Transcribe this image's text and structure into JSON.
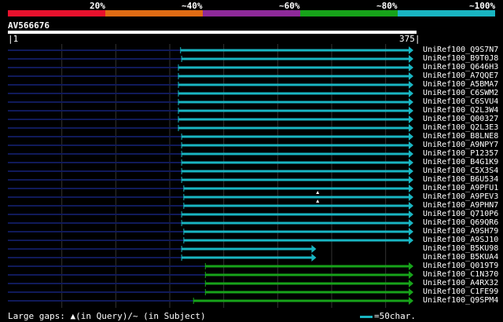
{
  "scale": {
    "segments": [
      {
        "color": "#e8112d"
      },
      {
        "color": "#e06c14"
      },
      {
        "color": "#8e2a9a"
      },
      {
        "color": "#17a31a"
      },
      {
        "color": "#19b5c2"
      }
    ],
    "labels": [
      "20%",
      "~40%",
      "~60%",
      "~80%",
      "~100%"
    ]
  },
  "query": {
    "id": "AV566676",
    "start": "1",
    "end": "375",
    "length": 375
  },
  "hits": [
    {
      "name": "UniRef100_Q9S7N7",
      "color": "#19b5c2",
      "start": 160,
      "end": 375,
      "arrow": true
    },
    {
      "name": "UniRef100_B9T0J8",
      "color": "#19b5c2",
      "start": 161,
      "end": 375
    },
    {
      "name": "UniRef100_Q646H3",
      "color": "#19b5c2",
      "start": 158,
      "end": 375
    },
    {
      "name": "UniRef100_A7QQE7",
      "color": "#19b5c2",
      "start": 158,
      "end": 375
    },
    {
      "name": "UniRef100_A5BMA7",
      "color": "#19b5c2",
      "start": 158,
      "end": 375
    },
    {
      "name": "UniRef100_C6SWM2",
      "color": "#19b5c2",
      "start": 158,
      "end": 375
    },
    {
      "name": "UniRef100_C6SVU4",
      "color": "#19b5c2",
      "start": 158,
      "end": 375
    },
    {
      "name": "UniRef100_Q2L3W4",
      "color": "#19b5c2",
      "start": 158,
      "end": 375
    },
    {
      "name": "UniRef100_Q00327",
      "color": "#19b5c2",
      "start": 158,
      "end": 375
    },
    {
      "name": "UniRef100_Q2L3E3",
      "color": "#19b5c2",
      "start": 158,
      "end": 375
    },
    {
      "name": "UniRef100_B8LNE8",
      "color": "#19b5c2",
      "start": 161,
      "end": 375
    },
    {
      "name": "UniRef100_A9NPY7",
      "color": "#19b5c2",
      "start": 161,
      "end": 375
    },
    {
      "name": "UniRef100_P12357",
      "color": "#19b5c2",
      "start": 161,
      "end": 375
    },
    {
      "name": "UniRef100_B4G1K9",
      "color": "#19b5c2",
      "start": 161,
      "end": 375
    },
    {
      "name": "UniRef100_C5X3S4",
      "color": "#19b5c2",
      "start": 161,
      "end": 375
    },
    {
      "name": "UniRef100_B6U534",
      "color": "#19b5c2",
      "start": 161,
      "end": 375
    },
    {
      "name": "UniRef100_A9PFU1",
      "color": "#19b5c2",
      "start": 163,
      "end": 375
    },
    {
      "name": "UniRef100_A9PEV3",
      "color": "#19b5c2",
      "start": 163,
      "end": 375,
      "gap": 287
    },
    {
      "name": "UniRef100_A9PHN7",
      "color": "#19b5c2",
      "start": 163,
      "end": 375,
      "gap": 287
    },
    {
      "name": "UniRef100_Q710P6",
      "color": "#19b5c2",
      "start": 161,
      "end": 375
    },
    {
      "name": "UniRef100_Q69QR6",
      "color": "#19b5c2",
      "start": 161,
      "end": 375
    },
    {
      "name": "UniRef100_A9SH79",
      "color": "#19b5c2",
      "start": 163,
      "end": 375
    },
    {
      "name": "UniRef100_A9SJ10",
      "color": "#19b5c2",
      "start": 163,
      "end": 375
    },
    {
      "name": "UniRef100_B5KU98",
      "color": "#19b5c2",
      "start": 161,
      "end": 285
    },
    {
      "name": "UniRef100_B5KUA4",
      "color": "#19b5c2",
      "start": 161,
      "end": 285
    },
    {
      "name": "UniRef100_Q019T9",
      "color": "#17a31a",
      "start": 183,
      "end": 375
    },
    {
      "name": "UniRef100_C1N370",
      "color": "#17a31a",
      "start": 183,
      "end": 375
    },
    {
      "name": "UniRef100_A4RX32",
      "color": "#17a31a",
      "start": 183,
      "end": 375
    },
    {
      "name": "UniRef100_C1FE99",
      "color": "#17a31a",
      "start": 183,
      "end": 375
    },
    {
      "name": "UniRef100_Q9SPM4",
      "color": "#17a31a",
      "start": 172,
      "end": 375
    }
  ],
  "legend": {
    "gaps_text": "Large gaps: ▲(in Query)/~ (in Subject)",
    "scale_text": "=50char.",
    "scale_color": "#19b5c2"
  },
  "colors": {
    "left_line": "#101a5a",
    "grid": "#333333",
    "gap_marker": "#ffffff"
  }
}
